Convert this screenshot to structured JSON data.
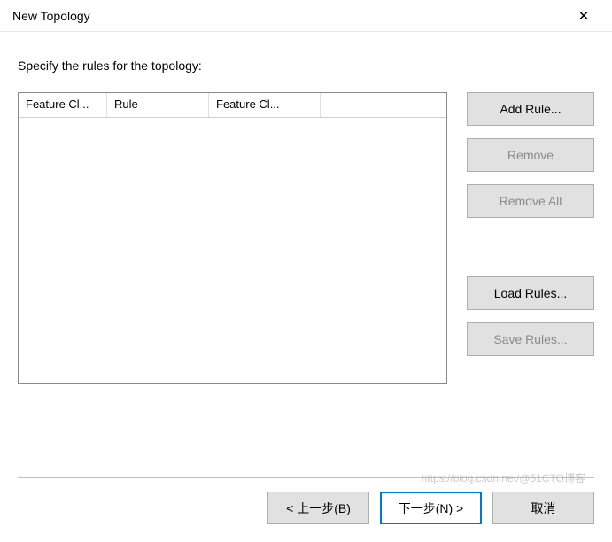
{
  "window": {
    "title": "New Topology"
  },
  "instruction": "Specify the rules for the topology:",
  "table": {
    "headers": {
      "col1": "Feature Cl...",
      "col2": "Rule",
      "col3": "Feature Cl...",
      "col4": ""
    }
  },
  "buttons": {
    "add_rule": "Add Rule...",
    "remove": "Remove",
    "remove_all": "Remove All",
    "load_rules": "Load Rules...",
    "save_rules": "Save Rules..."
  },
  "footer": {
    "back": "< 上一步(B)",
    "next": "下一步(N) >",
    "cancel": "取消"
  },
  "watermark": "https://blog.csdn.net/@51CTO博客"
}
